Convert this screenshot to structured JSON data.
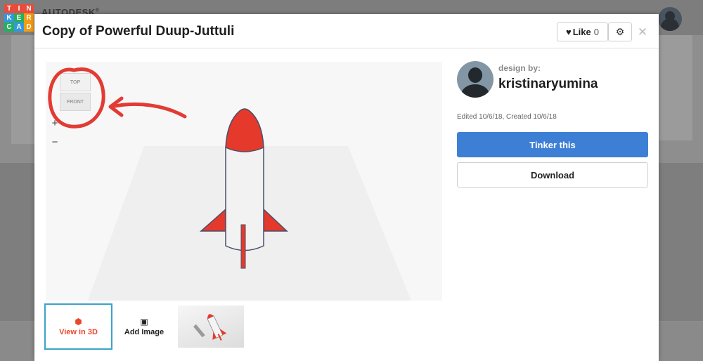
{
  "background": {
    "logo_letters": [
      "T",
      "I",
      "N",
      "K",
      "E",
      "R",
      "C",
      "A",
      "D"
    ],
    "logo_colors": [
      "#e74c3c",
      "#e74c3c",
      "#e74c3c",
      "#3498db",
      "#27ae60",
      "#f39c12",
      "#27ae60",
      "#3498db",
      "#f39c12"
    ],
    "brand": "AUTODESK",
    "brand_mark": "®"
  },
  "modal": {
    "title": "Copy of Powerful Duup-Juttuli",
    "like_label": "Like",
    "like_count": "0",
    "icons": {
      "heart": "heart-icon",
      "gear": "gear-icon",
      "close": "close-icon"
    }
  },
  "viewer": {
    "viewcube_top": "TOP",
    "viewcube_front": "FRONT",
    "zoom_in": "+",
    "zoom_out": "−",
    "colors": {
      "rocket_red": "#e5392b",
      "rocket_body": "#f2f2f2",
      "annotation": "#e23b34"
    }
  },
  "thumbnails": {
    "view_3d_label": "View in 3D",
    "add_image_label": "Add Image"
  },
  "sidebar": {
    "design_by_label": "design by:",
    "designer": "kristinaryumina",
    "dates": "Edited 10/6/18, Created 10/6/18",
    "tinker_label": "Tinker this",
    "download_label": "Download",
    "colors": {
      "primary": "#3e7fd6"
    }
  }
}
